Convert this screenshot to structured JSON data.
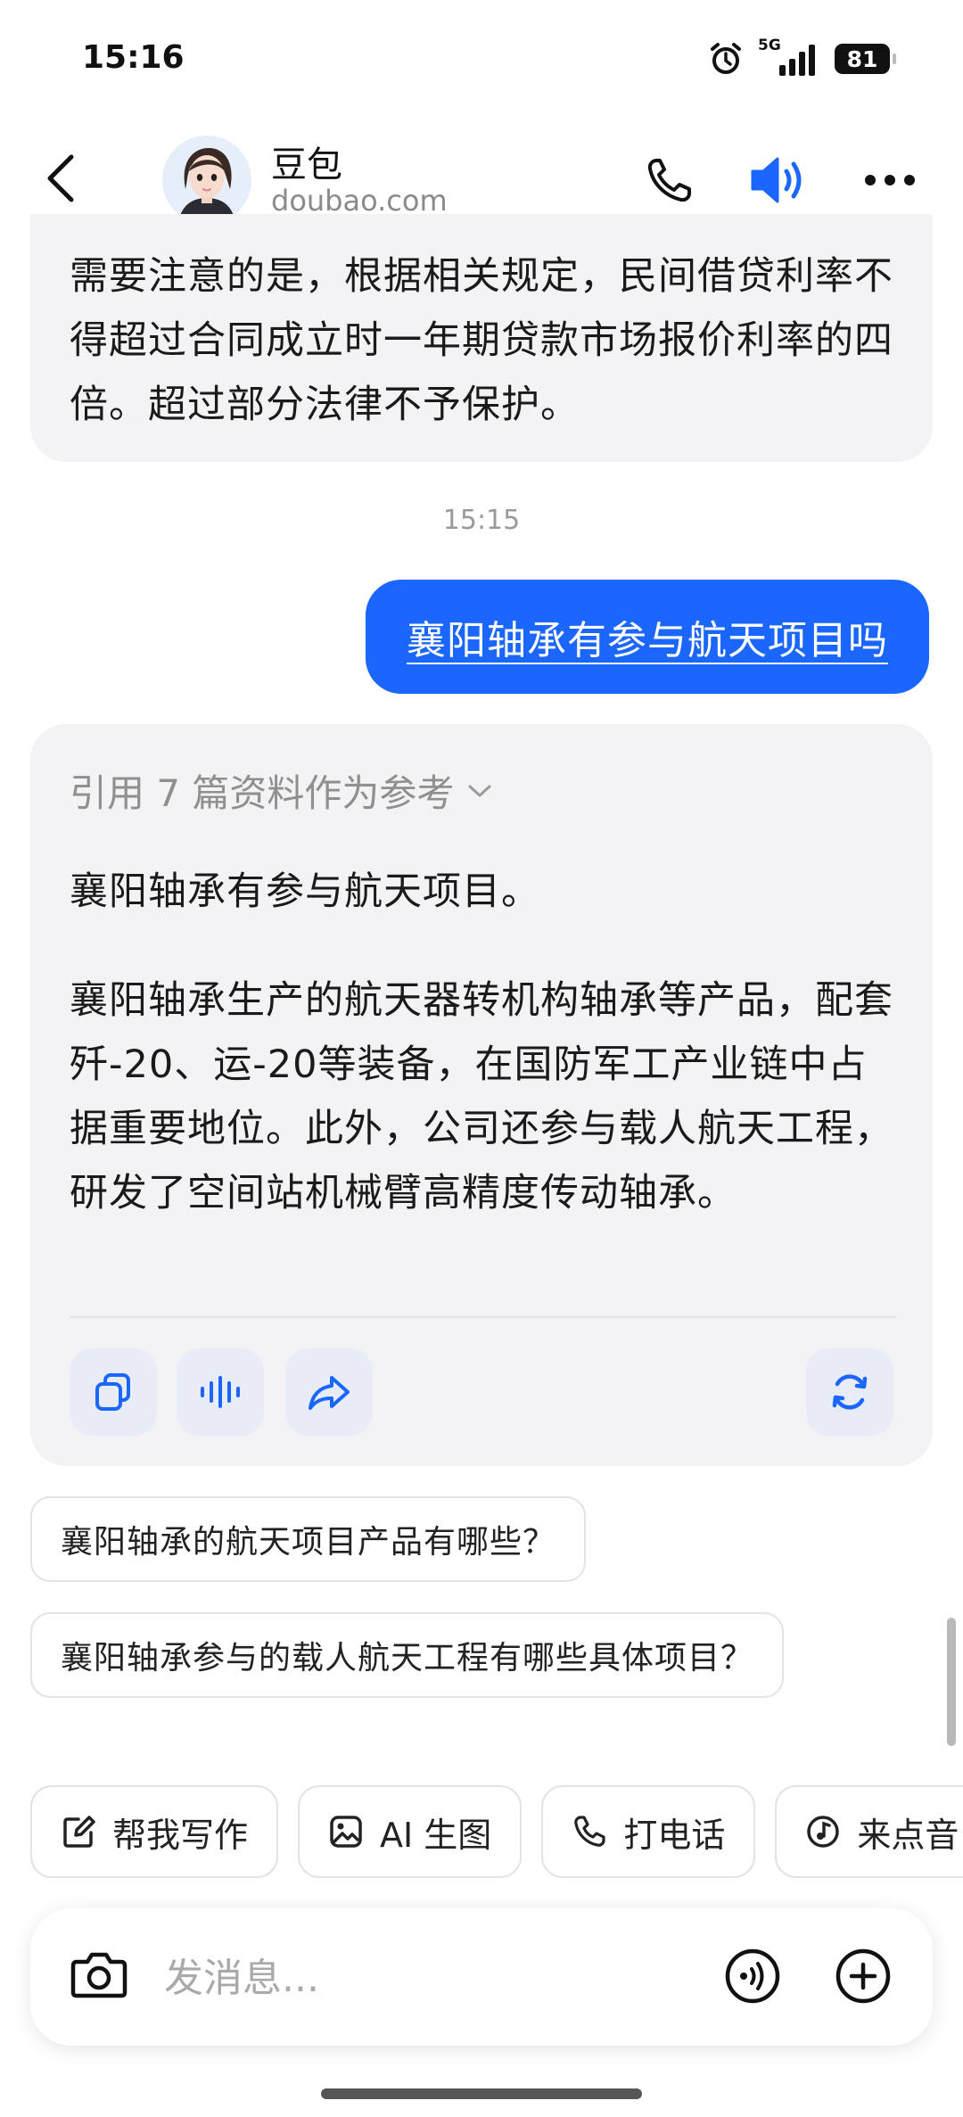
{
  "status_bar": {
    "time": "15:16",
    "network": "5G",
    "battery": "81"
  },
  "header": {
    "name": "豆包",
    "domain": "doubao.com"
  },
  "conversation": {
    "previous_reply": "需要注意的是，根据相关规定，民间借贷利率不得超过合同成立时一年期贷款市场报价利率的四倍。超过部分法律不予保护。",
    "timestamp": "15:15",
    "user_message": "襄阳轴承有参与航天项目吗",
    "answer": {
      "citation": "引用 7 篇资料作为参考",
      "paragraph_1": "襄阳轴承有参与航天项目。",
      "paragraph_2": "襄阳轴承生产的航天器转机构轴承等产品，配套歼-20、运-20等装备，在国防军工产业链中占据重要地位。此外，公司还参与载人航天工程，研发了空间站机械臂高精度传动轴承。"
    },
    "suggestions": [
      "襄阳轴承的航天项目产品有哪些？",
      "襄阳轴承参与的载人航天工程有哪些具体项目？"
    ]
  },
  "quick_actions": [
    {
      "label": "帮我写作",
      "icon": "edit-icon"
    },
    {
      "label": "AI 生图",
      "icon": "image-icon"
    },
    {
      "label": "打电话",
      "icon": "phone-icon"
    },
    {
      "label": "来点音",
      "icon": "music-icon"
    }
  ],
  "input": {
    "placeholder": "发消息..."
  },
  "colors": {
    "accent": "#1a66ff",
    "bubble_bg": "#f3f3f5",
    "action_btn_bg": "#e7ecf6"
  }
}
